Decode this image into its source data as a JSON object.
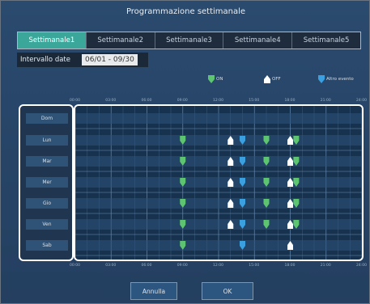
{
  "window": {
    "title": "Programmazione settimanale"
  },
  "tabs": [
    {
      "label": "Settimanale1",
      "active": true
    },
    {
      "label": "Settimanale2",
      "active": false
    },
    {
      "label": "Settimanale3",
      "active": false
    },
    {
      "label": "Settimanale4",
      "active": false
    },
    {
      "label": "Settimanale5",
      "active": false
    }
  ],
  "date_range": {
    "label": "Intervallo date",
    "value": "06/01 - 09/30"
  },
  "legend": {
    "on": {
      "label": "ON",
      "color": "#5dc46f",
      "icon": "on-marker-icon"
    },
    "off": {
      "label": "OFF",
      "color": "#ffffff",
      "icon": "off-marker-icon"
    },
    "other": {
      "label": "Altro evento",
      "color": "#3aa0e0",
      "icon": "other-event-marker-icon"
    }
  },
  "timeline": {
    "ticks": [
      "00:00",
      "03:00",
      "06:00",
      "09:00",
      "12:00",
      "15:00",
      "18:00",
      "21:00",
      "24:00"
    ]
  },
  "days": [
    "Dom",
    "Lun",
    "Mar",
    "Mer",
    "Gio",
    "Ven",
    "Sab"
  ],
  "events": {
    "Dom": [],
    "Lun": [
      {
        "type": "on",
        "time": "09:00"
      },
      {
        "type": "off",
        "time": "13:00"
      },
      {
        "type": "other",
        "time": "14:00"
      },
      {
        "type": "on",
        "time": "16:00"
      },
      {
        "type": "off",
        "time": "18:00"
      },
      {
        "type": "on",
        "time": "18:30"
      }
    ],
    "Mar": [
      {
        "type": "on",
        "time": "09:00"
      },
      {
        "type": "off",
        "time": "13:00"
      },
      {
        "type": "other",
        "time": "14:00"
      },
      {
        "type": "on",
        "time": "16:00"
      },
      {
        "type": "off",
        "time": "18:00"
      },
      {
        "type": "on",
        "time": "18:30"
      }
    ],
    "Mer": [
      {
        "type": "on",
        "time": "09:00"
      },
      {
        "type": "off",
        "time": "13:00"
      },
      {
        "type": "other",
        "time": "14:00"
      },
      {
        "type": "on",
        "time": "16:00"
      },
      {
        "type": "off",
        "time": "18:00"
      },
      {
        "type": "on",
        "time": "18:30"
      }
    ],
    "Gio": [
      {
        "type": "on",
        "time": "09:00"
      },
      {
        "type": "off",
        "time": "13:00"
      },
      {
        "type": "other",
        "time": "14:00"
      },
      {
        "type": "on",
        "time": "16:00"
      },
      {
        "type": "off",
        "time": "18:00"
      },
      {
        "type": "on",
        "time": "18:30"
      }
    ],
    "Ven": [
      {
        "type": "on",
        "time": "09:00"
      },
      {
        "type": "off",
        "time": "13:00"
      },
      {
        "type": "other",
        "time": "14:00"
      },
      {
        "type": "on",
        "time": "16:00"
      },
      {
        "type": "off",
        "time": "18:00"
      },
      {
        "type": "on",
        "time": "18:30"
      }
    ],
    "Sab": [
      {
        "type": "on",
        "time": "09:00"
      },
      {
        "type": "other",
        "time": "14:00"
      },
      {
        "type": "off",
        "time": "18:00"
      }
    ]
  },
  "buttons": {
    "cancel": "Annulla",
    "ok": "OK"
  }
}
